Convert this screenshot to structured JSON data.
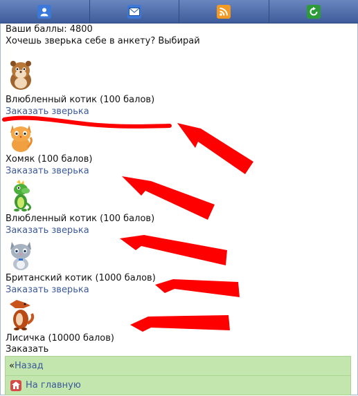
{
  "topbar": {
    "tabs": [
      {
        "icon": "user-icon",
        "color": "#3c78d8"
      },
      {
        "icon": "mail-icon",
        "color": "#3c78d8"
      },
      {
        "icon": "rss-icon",
        "color": "#f29a24"
      },
      {
        "icon": "refresh-icon",
        "color": "#2e9b3a"
      }
    ]
  },
  "header": {
    "points": "Ваши баллы: 4800",
    "prompt": "Хочешь зверька себе в анкету? Выбирай"
  },
  "animals": [
    {
      "name": "Влюбленный котик (100 балов)",
      "order": "Заказать зверька",
      "icon": "hamster-icon"
    },
    {
      "name": "Хомяк (100 балов)",
      "order": "Заказать зверька",
      "icon": "cat-icon"
    },
    {
      "name": "Влюбленный котик (100 балов)",
      "order": "Заказать зверька",
      "icon": "dragon-icon"
    },
    {
      "name": "Британский котик (1000 балов)",
      "order": "Заказать зверька",
      "icon": "gray-cat-icon"
    },
    {
      "name": "Лисичка (10000 балов)",
      "order": "Заказать",
      "icon": "fox-icon"
    }
  ],
  "nav": {
    "back_arrow": "«",
    "back": "Назад",
    "home": "На главную"
  },
  "colors": {
    "link": "#3b5998",
    "nav_bg": "#c3e6ae",
    "annotation": "#ff0000"
  }
}
